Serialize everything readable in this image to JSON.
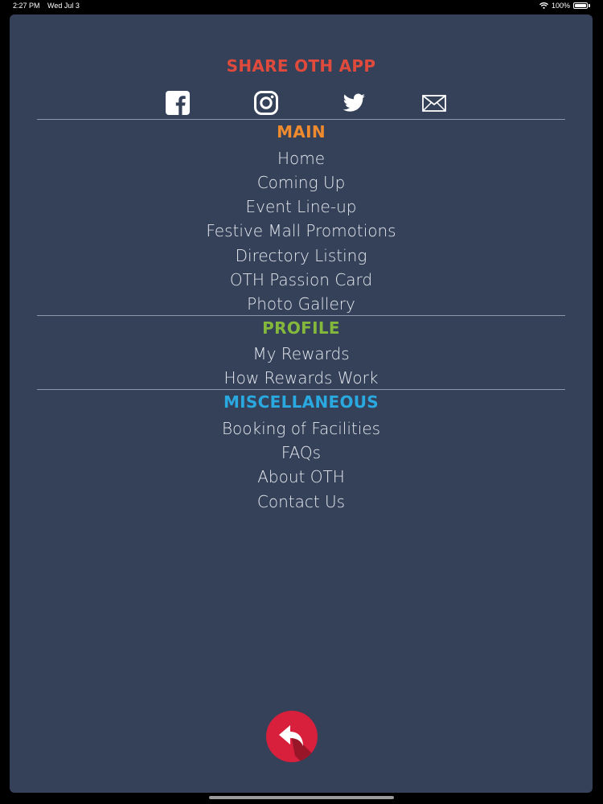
{
  "status_bar": {
    "time": "2:27 PM",
    "date": "Wed Jul 3",
    "battery": "100%"
  },
  "share": {
    "title": "SHARE OTH APP",
    "icons": [
      "facebook-icon",
      "instagram-icon",
      "twitter-icon",
      "mail-icon"
    ]
  },
  "sections": {
    "main": {
      "title": "MAIN",
      "color": "#ef8a2e",
      "items": [
        "Home",
        "Coming Up",
        "Event Line-up",
        "Festive Mall Promotions",
        "Directory Listing",
        "OTH Passion Card",
        "Photo Gallery"
      ]
    },
    "profile": {
      "title": "PROFILE",
      "color": "#84b83c",
      "items": [
        "My Rewards",
        "How Rewards Work"
      ]
    },
    "misc": {
      "title": "MISCELLANEOUS",
      "color": "#2aa8e0",
      "items": [
        "Booking of Facilities",
        "FAQs",
        "About OTH",
        "Contact Us"
      ]
    }
  },
  "back_button": {
    "icon": "reply-arrow-icon",
    "color": "#d8203c"
  }
}
